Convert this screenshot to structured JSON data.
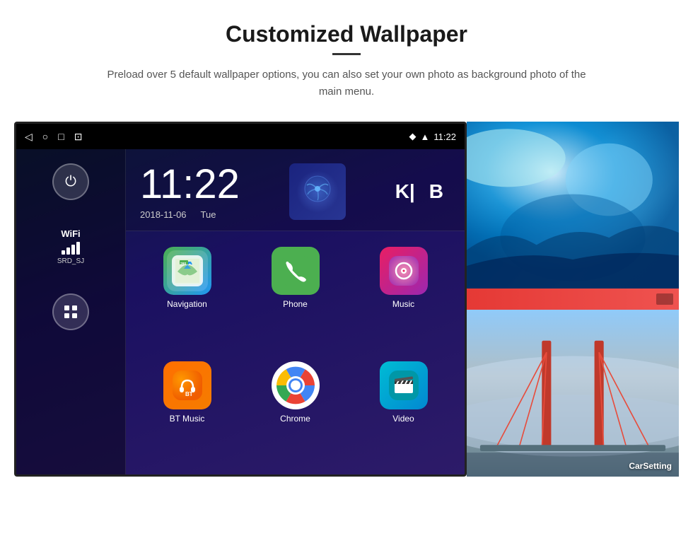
{
  "page": {
    "title": "Customized Wallpaper",
    "subtitle": "Preload over 5 default wallpaper options, you can also set your own photo as background photo of the main menu."
  },
  "status_bar": {
    "time": "11:22",
    "icons_left": [
      "back",
      "home",
      "recents",
      "screenshot"
    ],
    "icons_right": [
      "location",
      "wifi",
      "time"
    ]
  },
  "clock": {
    "time": "11:22",
    "date": "2018-11-06",
    "day": "Tue"
  },
  "sidebar": {
    "power_label": "⏻",
    "wifi_label": "WiFi",
    "wifi_ssid": "SRD_SJ",
    "apps_label": "⊞"
  },
  "apps": [
    {
      "name": "Navigation",
      "icon": "nav"
    },
    {
      "name": "Phone",
      "icon": "phone"
    },
    {
      "name": "Music",
      "icon": "music"
    },
    {
      "name": "BT Music",
      "icon": "bt"
    },
    {
      "name": "Chrome",
      "icon": "chrome"
    },
    {
      "name": "Video",
      "icon": "video"
    }
  ],
  "wallpapers": [
    {
      "label": ""
    },
    {
      "label": "CarSetting"
    }
  ],
  "media_letters": [
    "K|",
    "B"
  ]
}
